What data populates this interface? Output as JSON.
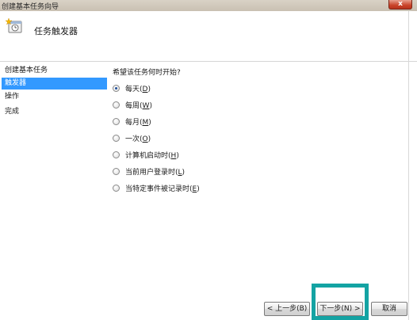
{
  "window": {
    "title": "创建基本任务向导",
    "close_label": "x"
  },
  "header": {
    "title": "任务触发器",
    "icon": "task-wizard-icon"
  },
  "sidebar": {
    "items": [
      {
        "label": "创建基本任务",
        "active": false
      },
      {
        "label": "触发器",
        "active": true
      },
      {
        "label": "操作",
        "active": false
      },
      {
        "label": "完成",
        "active": false
      }
    ]
  },
  "main": {
    "question": "希望该任务何时开始?",
    "options": [
      {
        "text": "每天",
        "key": "D",
        "checked": true
      },
      {
        "text": "每周",
        "key": "W",
        "checked": false
      },
      {
        "text": "每月",
        "key": "M",
        "checked": false
      },
      {
        "text": "一次",
        "key": "O",
        "checked": false
      },
      {
        "text": "计算机启动时",
        "key": "H",
        "checked": false
      },
      {
        "text": "当前用户登录时",
        "key": "L",
        "checked": false
      },
      {
        "text": "当特定事件被记录时",
        "key": "E",
        "checked": false
      }
    ]
  },
  "footer": {
    "back_label": "< 上一步(B)",
    "next_label": "下一步(N) >",
    "cancel_label": "取消"
  },
  "colors": {
    "selection": "#3399ff",
    "highlight": "#14a3a3"
  }
}
